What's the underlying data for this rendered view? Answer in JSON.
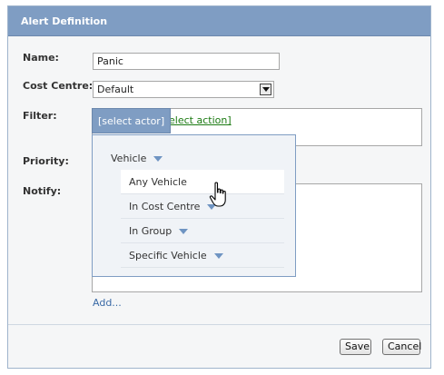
{
  "dialog": {
    "title": "Alert Definition",
    "fields": {
      "name_label": "Name:",
      "name_value": "Panic",
      "cost_centre_label": "Cost Centre:",
      "cost_centre_value": "Default",
      "filter_label": "Filter:",
      "priority_label": "Priority:",
      "notify_label": "Notify:"
    },
    "filter": {
      "actor_button": "[select actor]",
      "action_link": "[select action]"
    },
    "actor_menu": {
      "header": "Vehicle",
      "items": [
        {
          "label": "Any Vehicle",
          "has_dropdown": false
        },
        {
          "label": "In Cost Centre",
          "has_dropdown": true
        },
        {
          "label": "In Group",
          "has_dropdown": true
        },
        {
          "label": "Specific Vehicle",
          "has_dropdown": true
        }
      ]
    },
    "add_link": "Add...",
    "buttons": {
      "save": "Save",
      "cancel": "Cancel"
    }
  },
  "colors": {
    "title_bar": "#7f9dc3",
    "menu_arrow": "#6f94c2",
    "action_link": "#1b7a12",
    "add_link": "#3a6aa6"
  },
  "icons": {
    "cursor": "hand-pointer-icon",
    "menu_arrow": "triangle-down-icon",
    "select_arrow": "chevron-down-icon"
  }
}
